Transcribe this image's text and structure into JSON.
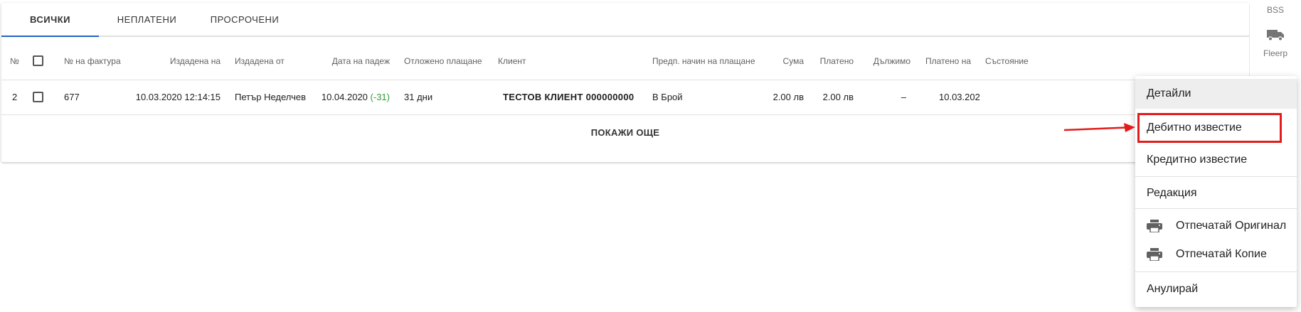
{
  "tabs": [
    {
      "label": "ВСИЧКИ",
      "active": true
    },
    {
      "label": "НЕПЛАТЕНИ",
      "active": false
    },
    {
      "label": "ПРОСРОЧЕНИ",
      "active": false
    }
  ],
  "table": {
    "headers": {
      "num": "№",
      "invoice": "№ на фактура",
      "issued_on": "Издадена на",
      "issued_by": "Издадена от",
      "due_date": "Дата на падеж",
      "deferred": "Отложено плащане",
      "client": "Клиент",
      "payment_method": "Предп. начин на плащане",
      "amount": "Сума",
      "paid": "Платено",
      "owed": "Дължимо",
      "paid_on": "Платено на",
      "status": "Състояние"
    },
    "rows": [
      {
        "num": "2",
        "invoice": "677",
        "issued_on": "10.03.2020 12:14:15",
        "issued_by": "Петър Неделчев",
        "due_date": "10.04.2020",
        "due_delta": "(-31)",
        "deferred": "31 дни",
        "client": "ТЕСТОВ КЛИЕНТ 000000000",
        "payment_method": "В Брой",
        "amount": "2.00 лв",
        "paid": "2.00 лв",
        "owed": "–",
        "paid_on": "10.03.202"
      }
    ]
  },
  "show_more": "ПОКАЖИ ОЩЕ",
  "sidebar": {
    "top_label": "BSS",
    "fleet_label": "Fleerp",
    "fleet_icon": "truck-icon"
  },
  "context_menu": {
    "items": [
      {
        "label": "Детайли",
        "highlighted": true
      },
      {
        "label": "Дебитно известие",
        "annotated": true
      },
      {
        "label": "Кредитно известие"
      },
      {
        "label": "Редакция"
      },
      {
        "label": "Отпечатай Оригинал",
        "icon": "printer-icon"
      },
      {
        "label": "Отпечатай Копие",
        "icon": "printer-icon"
      },
      {
        "label": "Анулирай"
      }
    ]
  },
  "colors": {
    "tab_indicator": "#1e63c8",
    "due_delta": "#2e9c38",
    "annotation": "#e31b1b"
  }
}
